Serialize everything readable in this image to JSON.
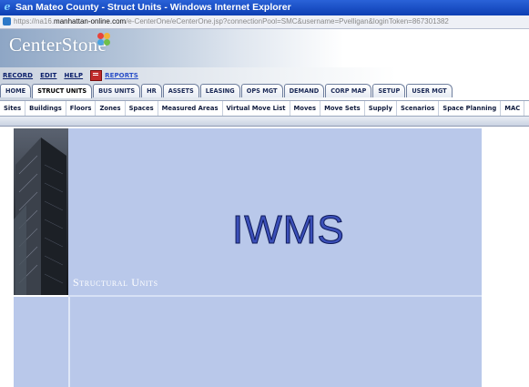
{
  "window": {
    "title": "San Mateo County - Struct Units - Windows Internet Explorer"
  },
  "address": {
    "scheme": "https://",
    "host_prefix": "na16.",
    "domain": "manhattan-online.com",
    "path": "/e-CenterOne/eCenterOne.jsp?connectionPool=SMC&username=Pvelligan&loginToken=867301382"
  },
  "logo": {
    "text": "CenterStone"
  },
  "menu": {
    "record": "RECORD",
    "edit": "EDIT",
    "help": "HELP",
    "reports": "REPORTS"
  },
  "tabs": [
    "HOME",
    "STRUCT UNITS",
    "BUS UNITS",
    "HR",
    "ASSETS",
    "LEASING",
    "OPS MGT",
    "DEMAND",
    "CORP MAP",
    "SETUP",
    "USER MGT"
  ],
  "active_tab": "STRUCT UNITS",
  "subnav": [
    "Sites",
    "Buildings",
    "Floors",
    "Zones",
    "Spaces",
    "Measured Areas",
    "Virtual Move List",
    "Moves",
    "Move Sets",
    "Supply",
    "Scenarios",
    "Space Planning",
    "MAC"
  ],
  "banner": {
    "heading": "IWMS",
    "section_label": "Structural Units"
  },
  "colors": {
    "titlebar": "#0d3fb3",
    "banner_bg": "#b9c8ea",
    "heading_fill": "#3b4fb8"
  }
}
